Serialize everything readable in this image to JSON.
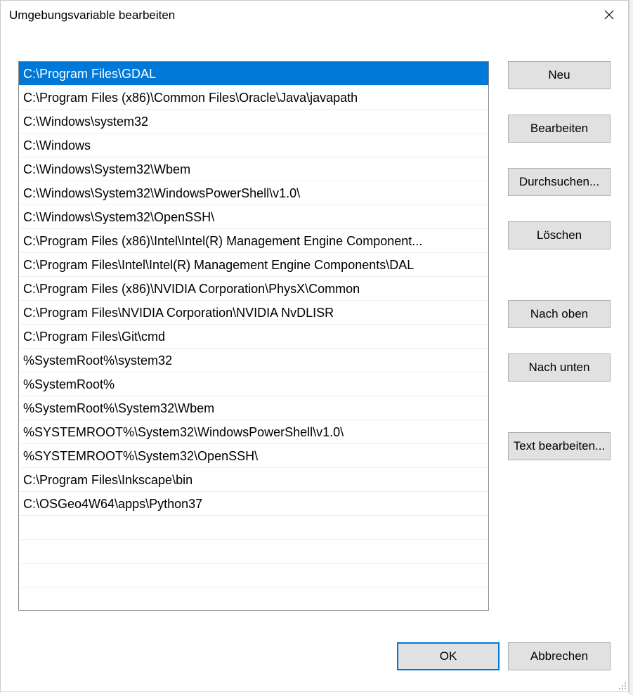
{
  "dialog": {
    "title": "Umgebungsvariable bearbeiten"
  },
  "paths": [
    "C:\\Program Files\\GDAL",
    "C:\\Program Files (x86)\\Common Files\\Oracle\\Java\\javapath",
    "C:\\Windows\\system32",
    "C:\\Windows",
    "C:\\Windows\\System32\\Wbem",
    "C:\\Windows\\System32\\WindowsPowerShell\\v1.0\\",
    "C:\\Windows\\System32\\OpenSSH\\",
    "C:\\Program Files (x86)\\Intel\\Intel(R) Management Engine Component...",
    "C:\\Program Files\\Intel\\Intel(R) Management Engine Components\\DAL",
    "C:\\Program Files (x86)\\NVIDIA Corporation\\PhysX\\Common",
    "C:\\Program Files\\NVIDIA Corporation\\NVIDIA NvDLISR",
    "C:\\Program Files\\Git\\cmd",
    "%SystemRoot%\\system32",
    "%SystemRoot%",
    "%SystemRoot%\\System32\\Wbem",
    "%SYSTEMROOT%\\System32\\WindowsPowerShell\\v1.0\\",
    "%SYSTEMROOT%\\System32\\OpenSSH\\",
    "C:\\Program Files\\Inkscape\\bin",
    "C:\\OSGeo4W64\\apps\\Python37"
  ],
  "selected_index": 0,
  "empty_rows": 4,
  "buttons": {
    "new": "Neu",
    "edit": "Bearbeiten",
    "browse": "Durchsuchen...",
    "delete": "Löschen",
    "move_up": "Nach oben",
    "move_down": "Nach unten",
    "edit_text": "Text bearbeiten...",
    "ok": "OK",
    "cancel": "Abbrechen"
  }
}
